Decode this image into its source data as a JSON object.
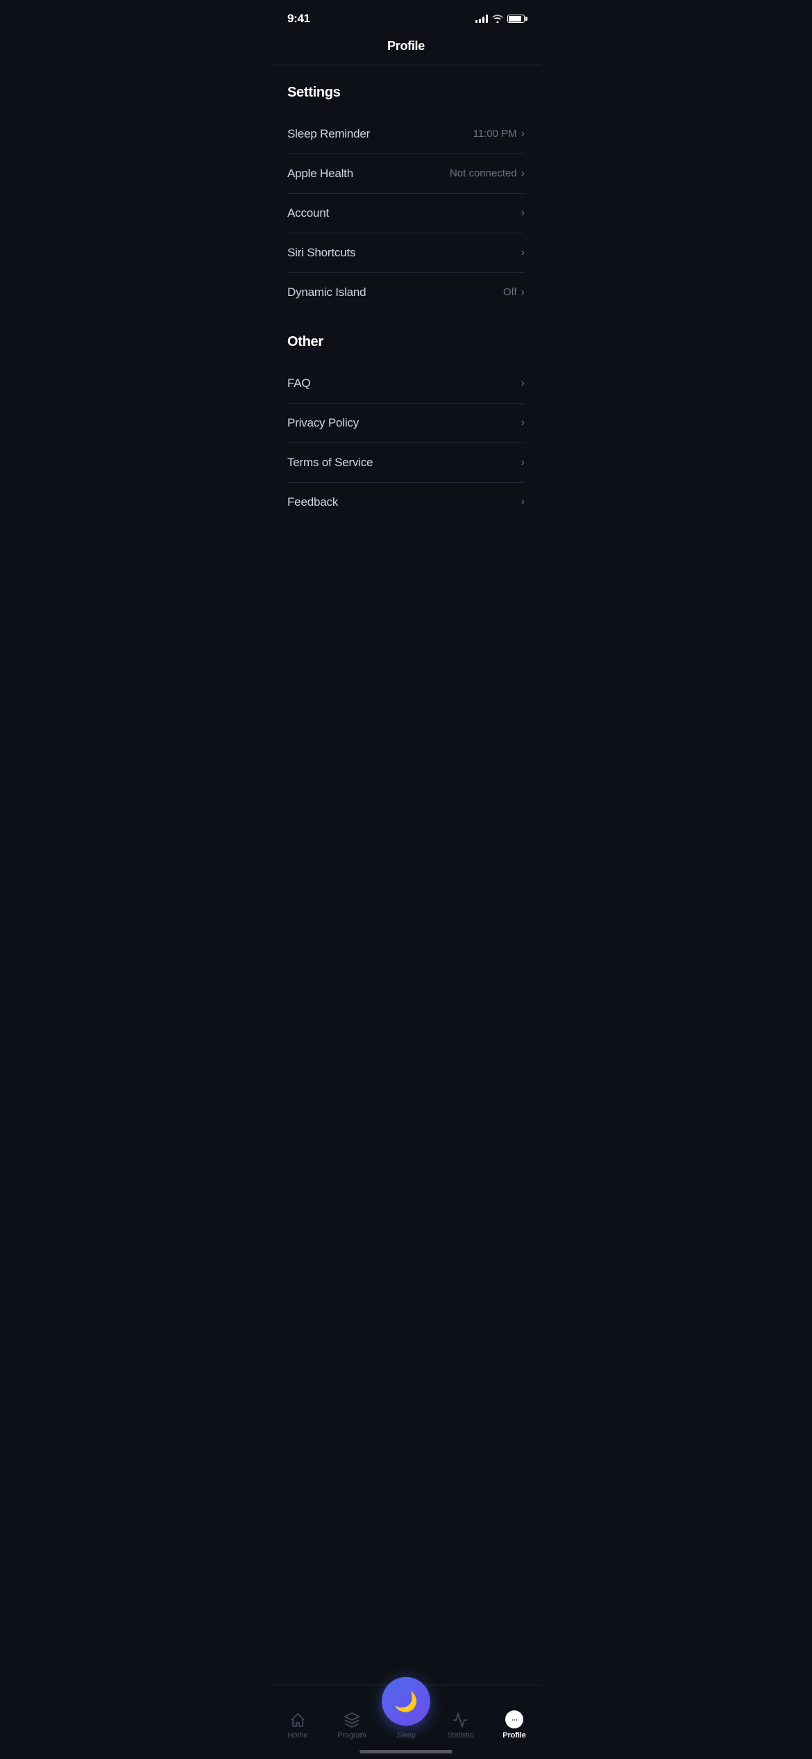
{
  "statusBar": {
    "time": "9:41",
    "battery": 85
  },
  "header": {
    "title": "Profile"
  },
  "settings": {
    "sectionLabel": "Settings",
    "items": [
      {
        "id": "sleep-reminder",
        "label": "Sleep Reminder",
        "value": "11:00 PM",
        "hasChevron": true
      },
      {
        "id": "apple-health",
        "label": "Apple Health",
        "value": "Not connected",
        "hasChevron": true
      },
      {
        "id": "account",
        "label": "Account",
        "value": "",
        "hasChevron": true
      },
      {
        "id": "siri-shortcuts",
        "label": "Siri Shortcuts",
        "value": "",
        "hasChevron": true
      },
      {
        "id": "dynamic-island",
        "label": "Dynamic Island",
        "value": "Off",
        "hasChevron": true
      }
    ]
  },
  "other": {
    "sectionLabel": "Other",
    "items": [
      {
        "id": "faq",
        "label": "FAQ",
        "value": "",
        "hasChevron": true
      },
      {
        "id": "privacy-policy",
        "label": "Privacy Policy",
        "value": "",
        "hasChevron": true
      },
      {
        "id": "terms-of-service",
        "label": "Terms of Service",
        "value": "",
        "hasChevron": true
      },
      {
        "id": "feedback",
        "label": "Feedback",
        "value": "",
        "hasChevron": true
      }
    ]
  },
  "tabBar": {
    "items": [
      {
        "id": "home",
        "label": "Home",
        "active": false
      },
      {
        "id": "program",
        "label": "Program",
        "active": false
      },
      {
        "id": "sleep",
        "label": "Sleep",
        "active": false
      },
      {
        "id": "statistic",
        "label": "Statistic",
        "active": false
      },
      {
        "id": "profile",
        "label": "Profile",
        "active": true
      }
    ]
  },
  "icons": {
    "chevron": "›",
    "moon": "🌙"
  }
}
